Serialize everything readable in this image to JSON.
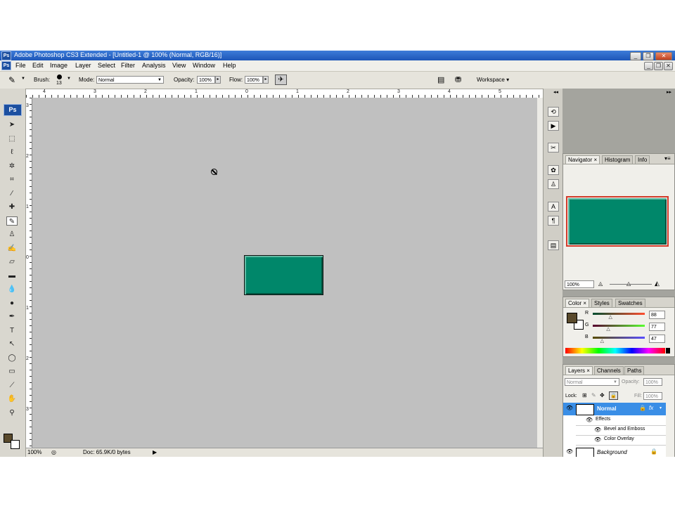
{
  "window": {
    "title": "Adobe Photoshop CS3 Extended - [Untitled-1 @ 100% (Normal, RGB/16)]",
    "logo": "Ps",
    "controls": [
      "_",
      "❐",
      "✕"
    ]
  },
  "menu": [
    "File",
    "Edit",
    "Image",
    "Layer",
    "Select",
    "Filter",
    "Analysis",
    "View",
    "Window",
    "Help"
  ],
  "options": {
    "brush_label": "Brush:",
    "brush_size": "13",
    "mode_label": "Mode:",
    "mode_value": "Normal",
    "opacity_label": "Opacity:",
    "opacity_value": "100%",
    "flow_label": "Flow:",
    "flow_value": "100%",
    "workspace_label": "Workspace ▾"
  },
  "toolbox": {
    "logo": "Ps",
    "tools": [
      {
        "name": "move-tool-icon",
        "glyph": "➤"
      },
      {
        "name": "marquee-tool-icon",
        "glyph": "⬚"
      },
      {
        "name": "lasso-tool-icon",
        "glyph": "ℓ"
      },
      {
        "name": "magic-wand-tool-icon",
        "glyph": "✲"
      },
      {
        "name": "crop-tool-icon",
        "glyph": "⌗"
      },
      {
        "name": "slice-tool-icon",
        "glyph": "⁄"
      },
      {
        "name": "healing-brush-tool-icon",
        "glyph": "✚"
      },
      {
        "name": "brush-tool-icon",
        "glyph": "✎"
      },
      {
        "name": "clone-stamp-tool-icon",
        "glyph": "♙"
      },
      {
        "name": "history-brush-tool-icon",
        "glyph": "✍"
      },
      {
        "name": "eraser-tool-icon",
        "glyph": "▱"
      },
      {
        "name": "gradient-tool-icon",
        "glyph": "▬"
      },
      {
        "name": "blur-tool-icon",
        "glyph": "💧"
      },
      {
        "name": "dodge-tool-icon",
        "glyph": "●"
      },
      {
        "name": "pen-tool-icon",
        "glyph": "✒"
      },
      {
        "name": "type-tool-icon",
        "glyph": "T"
      },
      {
        "name": "path-selection-tool-icon",
        "glyph": "↖"
      },
      {
        "name": "shape-tool-icon",
        "glyph": "◯"
      },
      {
        "name": "notes-tool-icon",
        "glyph": "▭"
      },
      {
        "name": "eyedropper-tool-icon",
        "glyph": "⟋"
      },
      {
        "name": "hand-tool-icon",
        "glyph": "✋"
      },
      {
        "name": "zoom-tool-icon",
        "glyph": "⚲"
      }
    ],
    "foreground_color": "#5a4a2c",
    "background_color": "#ffffff"
  },
  "ruler_top_labels": [
    "4",
    "3",
    "2",
    "1",
    "0",
    "1",
    "2",
    "3",
    "4",
    "5"
  ],
  "ruler_left_labels": [
    "3",
    "2",
    "1",
    "0",
    "1",
    "2",
    "3"
  ],
  "canvas": {
    "background": "#c0c0c0",
    "shape_color": "#00876a"
  },
  "status": {
    "zoom": "100%",
    "doc": "Doc: 65.9K/0 bytes"
  },
  "navigator": {
    "tabs": [
      "Navigator ×",
      "Histogram",
      "Info"
    ],
    "zoom": "100%"
  },
  "color_panel": {
    "tabs": [
      "Color ×",
      "Styles",
      "Swatches"
    ],
    "r_label": "R",
    "r_value": "88",
    "g_label": "G",
    "g_value": "77",
    "b_label": "B",
    "b_value": "47",
    "r_fraction": 0.345,
    "g_fraction": 0.302,
    "b_fraction": 0.184
  },
  "layers_panel": {
    "tabs": [
      "Layers ×",
      "Channels",
      "Paths"
    ],
    "blend_mode": "Normal",
    "opacity_label": "Opacity:",
    "opacity_value": "100%",
    "lock_label": "Lock:",
    "fill_label": "Fill:",
    "fill_value": "100%",
    "layers": {
      "top_name": "Normal",
      "effects_label": "Effects",
      "effect1": "Bevel and Emboss",
      "effect2": "Color Overlay",
      "background_name": "Background"
    },
    "selected_color": "#3a8ee6"
  }
}
